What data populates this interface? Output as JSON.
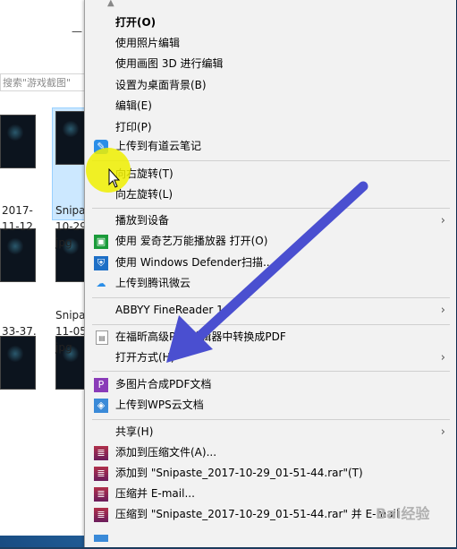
{
  "explorer": {
    "search_placeholder": "搜索\"游戏截图\"",
    "files": [
      {
        "line1": "2017-",
        "line2": "11-12."
      },
      {
        "line1": "Snipa",
        "line2": "10-29",
        "line3": "jpg"
      },
      {
        "line1": "33-37."
      },
      {
        "line1": "Snipa",
        "line2": "11-05",
        "line3": "jpg"
      }
    ]
  },
  "menu": {
    "items": [
      {
        "label": "打开(O)",
        "icon": null
      },
      {
        "label": "使用照片编辑",
        "icon": null
      },
      {
        "label": "使用画图 3D 进行编辑",
        "icon": null
      },
      {
        "label": "设置为桌面背景(B)",
        "icon": null
      },
      {
        "label": "编辑(E)",
        "icon": null
      },
      {
        "label": "打印(P)",
        "icon": null
      },
      {
        "label": "上传到有道云笔记",
        "icon": "youdao-note-icon"
      },
      {
        "label": "向右旋转(T)",
        "icon": null
      },
      {
        "label": "向左旋转(L)",
        "icon": null
      },
      {
        "label": "播放到设备",
        "icon": null,
        "submenu": true
      },
      {
        "label": "使用 爱奇艺万能播放器 打开(O)",
        "icon": "iqiyi-player-icon"
      },
      {
        "label": "使用 Windows Defender扫描...",
        "icon": "windows-defender-icon"
      },
      {
        "label": "上传到腾讯微云",
        "icon": "weiyun-icon"
      },
      {
        "label": "ABBYY FineReader 14",
        "icon": null,
        "submenu": true
      },
      {
        "label": "在福昕高级PDF编辑器中转换成PDF",
        "icon": "foxit-pdf-icon"
      },
      {
        "label": "打开方式(H)",
        "icon": null,
        "submenu": true
      },
      {
        "label": "多图片合成PDF文档",
        "icon": "merge-pdf-icon"
      },
      {
        "label": "上传到WPS云文档",
        "icon": "wps-cloud-icon"
      },
      {
        "label": "共享(H)",
        "icon": null,
        "submenu": true
      },
      {
        "label": "添加到压缩文件(A)...",
        "icon": "winrar-icon"
      },
      {
        "label": "添加到 \"Snipaste_2017-10-29_01-51-44.rar\"(T)",
        "icon": "winrar-icon"
      },
      {
        "label": "压缩并 E-mail...",
        "icon": "winrar-icon"
      },
      {
        "label": "压缩到 \"Snipaste_2017-10-29_01-51-44.rar\" 并 E-mail",
        "icon": "winrar-icon"
      }
    ]
  },
  "colors": {
    "menu_bg": "#f2f2f2",
    "highlight_yellow": "#f0f000",
    "arrow_blue": "#4a4fd0"
  },
  "watermark": "Bai经验"
}
